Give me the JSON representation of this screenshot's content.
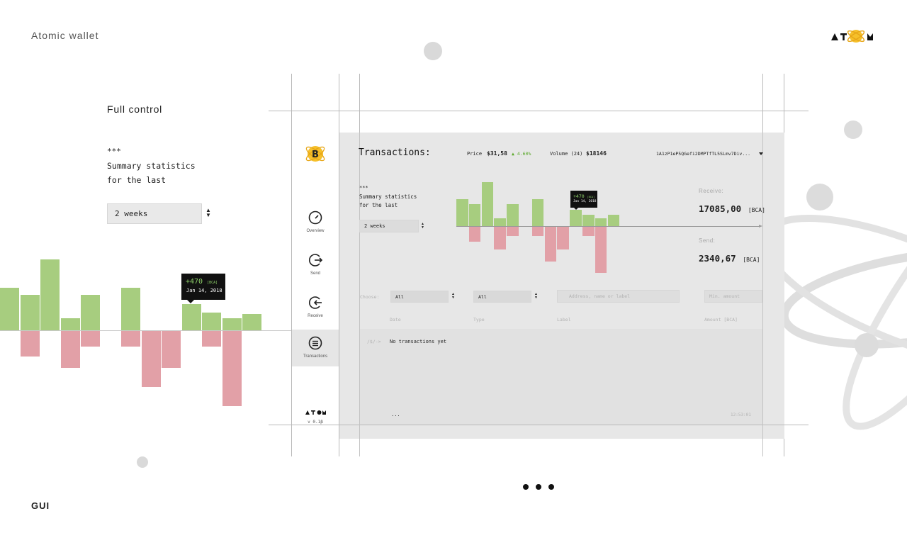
{
  "page": {
    "title": "Atomic wallet",
    "section_label": "GUI",
    "logo_text": "ATOM"
  },
  "intro": {
    "heading": "Full control",
    "stars": "***",
    "line1": "Summary statistics",
    "line2": "for the last",
    "period_value": "2 weeks"
  },
  "big_chart": {
    "tooltip_value": "+470",
    "tooltip_unit": "[BCA]",
    "tooltip_date": "Jan 14, 2018"
  },
  "sidebar": {
    "items": [
      {
        "label": "Overview",
        "icon": "speedometer-icon"
      },
      {
        "label": "Send",
        "icon": "send-arrow-icon"
      },
      {
        "label": "Receive",
        "icon": "receive-arrow-icon"
      },
      {
        "label": "Transactions",
        "icon": "list-circle-icon"
      }
    ],
    "brand": "ATOM",
    "version": "v 0.1β"
  },
  "header": {
    "title": "Transactions:",
    "price_label": "Price",
    "price_value": "$31,58",
    "price_change": "▲ 4.60%",
    "volume_label": "Volume (24)",
    "volume_value": "$18146",
    "address": "1A1zP1eP5QGefi2DMPTfTL5SLmv7Div..."
  },
  "summary": {
    "stars": "***",
    "line1": "Summary statistics",
    "line2": "for the last",
    "period_value": "2 weeks",
    "tooltip_value": "+470",
    "tooltip_unit": "[BCA]",
    "tooltip_date": "Jan 14, 2018"
  },
  "totals": {
    "receive_label": "Receive:",
    "receive_value": "17085,00",
    "receive_unit": "[BCA]",
    "send_label": "Send:",
    "send_value": "2340,67",
    "send_unit": "[BCA]"
  },
  "filters": {
    "choose_label": "Choose:",
    "filter1_value": "All",
    "filter2_value": "All",
    "search_placeholder": "Address, name or label",
    "amount_placeholder": "Min. amount"
  },
  "table": {
    "columns": [
      "Date",
      "Type",
      "Label",
      "Amount [BCA]"
    ],
    "prompt": "/$/->",
    "empty_text": "No transactions yet",
    "ellipsis": "...",
    "time": "12:53:01"
  },
  "colors": {
    "receive_bar": "#a7cd7f",
    "send_bar": "#e2a0a7",
    "accent_green": "#7bc043",
    "panel_bg": "#e7e7e7",
    "tooltip_bg": "#111111"
  },
  "chart_data": [
    {
      "type": "bar",
      "receive_values": [
        60,
        50,
        100,
        17,
        50,
        0,
        60,
        0,
        0,
        37,
        25,
        17,
        23
      ],
      "send_values": [
        0,
        37,
        0,
        53,
        23,
        0,
        23,
        80,
        53,
        0,
        23,
        107,
        0
      ],
      "highlight_index": 9
    },
    {
      "type": "bar",
      "receive_values": [
        38,
        31,
        62,
        11,
        31,
        0,
        38,
        0,
        0,
        23,
        16,
        11,
        16
      ],
      "send_values": [
        0,
        22,
        0,
        33,
        14,
        0,
        14,
        50,
        33,
        0,
        14,
        66,
        0
      ],
      "highlight_index": 9
    }
  ]
}
